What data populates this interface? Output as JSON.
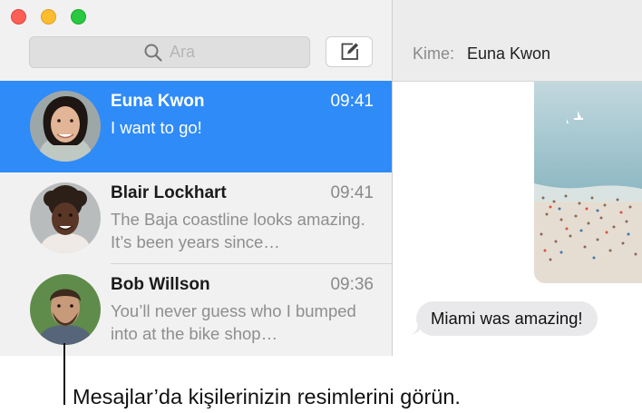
{
  "window": {
    "controls": {
      "close": "close-icon",
      "minimize": "minimize-icon",
      "zoom": "zoom-icon"
    }
  },
  "search": {
    "placeholder": "Ara",
    "icon": "search-icon"
  },
  "compose": {
    "icon": "compose-icon"
  },
  "conversations": [
    {
      "name": "Euna Kwon",
      "time": "09:41",
      "preview": "I want to go!",
      "selected": true
    },
    {
      "name": "Blair Lockhart",
      "time": "09:41",
      "preview": "The Baja coastline looks amazing. It’s been years since…",
      "selected": false
    },
    {
      "name": "Bob Willson",
      "time": "09:36",
      "preview": "You’ll never guess who I bumped into at the bike shop…",
      "selected": false
    }
  ],
  "detail": {
    "to_label": "Kime:",
    "to_name": "Euna Kwon",
    "messages": [
      {
        "text": "Miami was amazing!",
        "from": "other"
      }
    ]
  },
  "caption": "Mesajlar’da kişilerinizin resimlerini görün.",
  "colors": {
    "selection": "#2f8bf8",
    "bubble": "#e9e9eb",
    "sidebar": "#f2f1f2"
  }
}
